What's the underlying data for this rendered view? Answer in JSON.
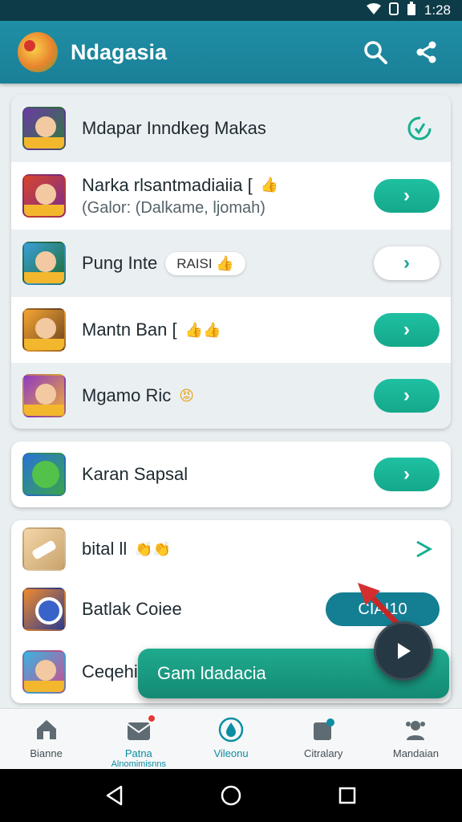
{
  "status_bar": {
    "time": "1:28"
  },
  "app_bar": {
    "title": "Ndagasia"
  },
  "list_group_1": [
    {
      "title": "Mdapar Inndkeg Makas",
      "subtitle": "",
      "tag": "",
      "emoji": "",
      "action": "refresh"
    },
    {
      "title": "Narka rlsantmadiaiia [",
      "subtitle": "(Galor: (Dalkame, ljomah)",
      "tag": "",
      "emoji": "👍",
      "action": "go"
    },
    {
      "title": "Pung Inte",
      "subtitle": "",
      "tag": "RAISI",
      "emoji": "👍",
      "action": "go-white"
    },
    {
      "title": "Mantn Ban [",
      "subtitle": "",
      "tag": "",
      "emoji": "👍👍",
      "action": "go"
    },
    {
      "title": "Mgamo Ric",
      "subtitle": "",
      "tag": "",
      "emoji": "😡",
      "action": "go"
    }
  ],
  "list_group_2": [
    {
      "title": "Karan Sapsal",
      "action": "go"
    }
  ],
  "list_group_3": [
    {
      "title": "bital ll",
      "emoji": "👏👏",
      "action": "next"
    },
    {
      "title": "Batlak Coiee",
      "button_label": "CIAI10",
      "action": "wide"
    },
    {
      "title": "Ceqehi",
      "action": "none"
    }
  ],
  "fab": {
    "label": "Gam ldadacia"
  },
  "bottom_nav": [
    {
      "label": "Bianne",
      "sub": ""
    },
    {
      "label": "Patna",
      "sub": "Alnomimisnns"
    },
    {
      "label": "Vileonu",
      "sub": ""
    },
    {
      "label": "Citralary",
      "sub": ""
    },
    {
      "label": "Mandaian",
      "sub": ""
    }
  ],
  "colors": {
    "primary": "#1a7f97",
    "accent": "#14a88b",
    "status_bar": "#0e3b48"
  }
}
